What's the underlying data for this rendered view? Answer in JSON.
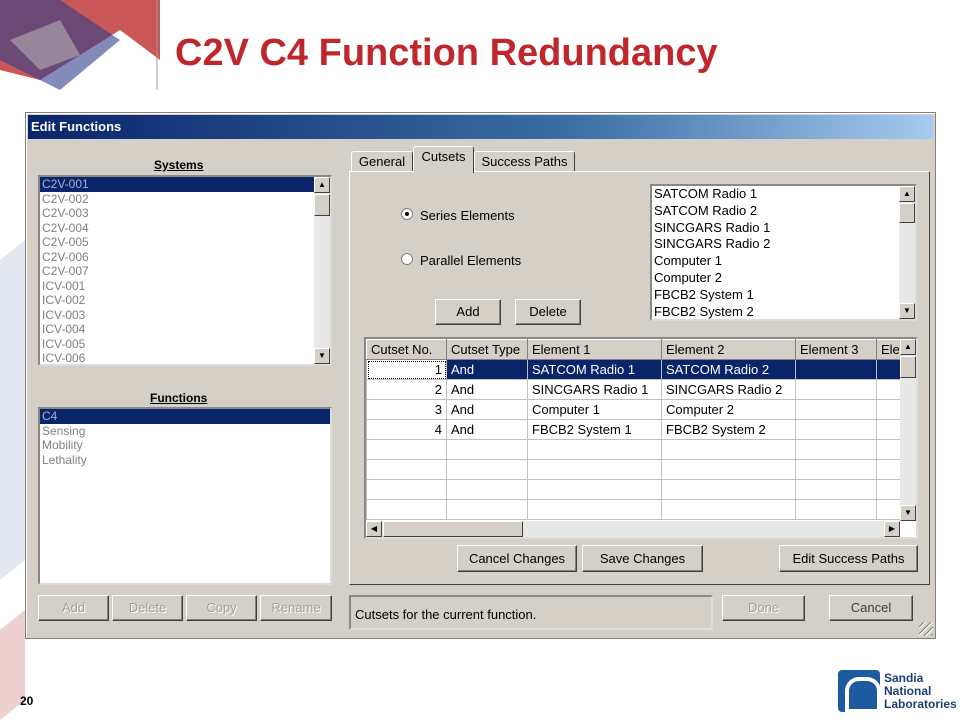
{
  "slide": {
    "title": "C2V C4 Function Redundancy",
    "page_number": "20",
    "logo_lines": [
      "Sandia",
      "National",
      "Laboratories"
    ]
  },
  "window": {
    "title": "Edit Functions",
    "systems_label": "Systems",
    "systems": [
      "C2V-001",
      "C2V-002",
      "C2V-003",
      "C2V-004",
      "C2V-005",
      "C2V-006",
      "C2V-007",
      "ICV-001",
      "ICV-002",
      "ICV-003",
      "ICV-004",
      "ICV-005",
      "ICV-006"
    ],
    "functions_label": "Functions",
    "functions": [
      "C4",
      "Sensing",
      "Mobility",
      "Lethality"
    ],
    "left_buttons": {
      "add": "Add",
      "delete": "Delete",
      "copy": "Copy",
      "rename": "Rename"
    },
    "tabs": [
      "General",
      "Cutsets",
      "Success Paths"
    ],
    "active_tab": "Cutsets",
    "radio": {
      "series": "Series Elements",
      "parallel": "Parallel Elements",
      "selected": "series"
    },
    "elements": [
      "SATCOM Radio 1",
      "SATCOM Radio 2",
      "SINCGARS Radio 1",
      "SINCGARS Radio 2",
      "Computer 1",
      "Computer 2",
      "FBCB2 System 1",
      "FBCB2 System 2"
    ],
    "element_buttons": {
      "add": "Add",
      "delete": "Delete"
    },
    "grid": {
      "columns": [
        "Cutset No.",
        "Cutset Type",
        "Element 1",
        "Element 2",
        "Element 3",
        "Ele"
      ],
      "rows": [
        {
          "no": "1",
          "type": "And",
          "e1": "SATCOM Radio 1",
          "e2": "SATCOM Radio 2",
          "e3": ""
        },
        {
          "no": "2",
          "type": "And",
          "e1": "SINCGARS Radio 1",
          "e2": "SINCGARS Radio 2",
          "e3": ""
        },
        {
          "no": "3",
          "type": "And",
          "e1": "Computer 1",
          "e2": "Computer 2",
          "e3": ""
        },
        {
          "no": "4",
          "type": "And",
          "e1": "FBCB2 System 1",
          "e2": "FBCB2 System 2",
          "e3": ""
        }
      ]
    },
    "panel_buttons": {
      "cancel": "Cancel Changes",
      "save": "Save Changes",
      "edit": "Edit Success Paths"
    },
    "status_text": "Cutsets for the current function.",
    "footer_buttons": {
      "done": "Done",
      "cancel": "Cancel"
    }
  },
  "colors": {
    "title": "#c0272d",
    "selection": "#0a246a",
    "window_bg": "#d4d0c8"
  }
}
